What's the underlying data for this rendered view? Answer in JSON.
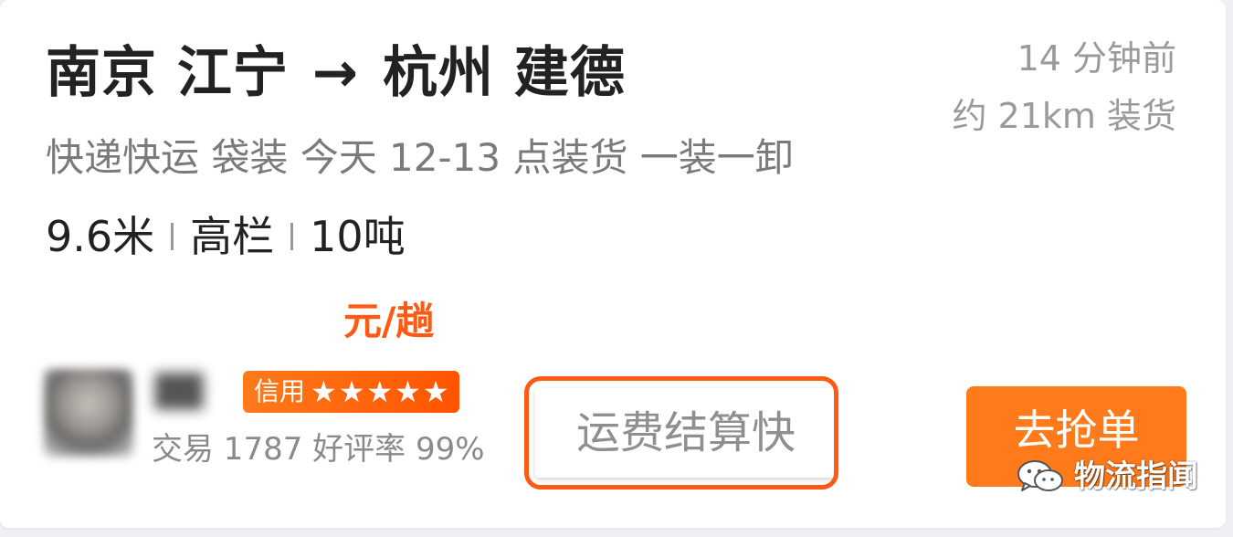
{
  "order": {
    "origin": "南京 江宁",
    "arrow": "→",
    "destination": "杭州 建德",
    "posted_time": "14 分钟前",
    "loading_distance": "约 21km 装货",
    "description": "快递快运 袋装 今天 12-13 点装货 一装一卸",
    "specs": [
      "9.6米",
      "高栏",
      "10吨"
    ],
    "price_unit": "元/趟"
  },
  "shipper": {
    "credit_label": "信用",
    "stars": "★★★★★",
    "star_count": 5,
    "trade_stats": "交易 1787 好评率 99%"
  },
  "tag": {
    "label": "运费结算快"
  },
  "actions": {
    "grab_label": "去抢单"
  },
  "watermark": {
    "text": "物流指闻",
    "icon": "wechat-icon"
  },
  "colors": {
    "accent_orange": "#ff7a1a",
    "price_orange": "#ff5a14",
    "title_text": "#222222",
    "muted_text": "#9a9a9a"
  }
}
